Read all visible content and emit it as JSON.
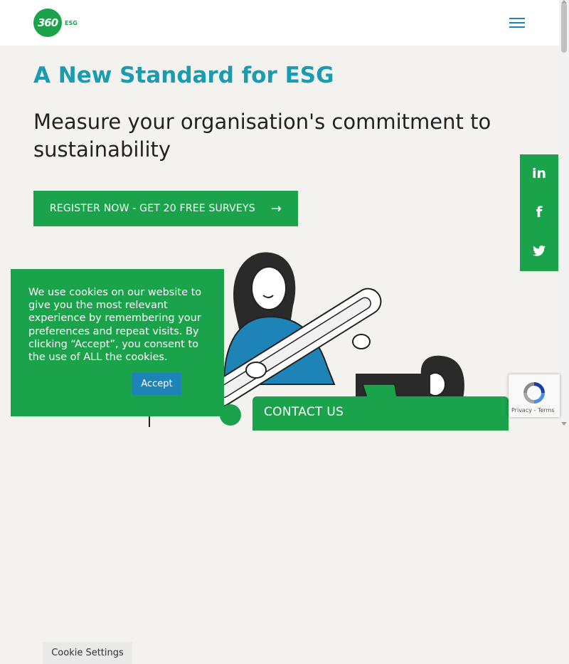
{
  "header": {
    "logo_mark": "360",
    "logo_text": "ESG",
    "menu_icon": "hamburger-icon"
  },
  "hero": {
    "title": "A New Standard for ESG",
    "subtitle": "Measure your organisation's commitment to sustainability",
    "cta_label": "REGISTER NOW - GET 20 FREE SURVEYS",
    "cta_icon": "arrow-right-icon"
  },
  "social": {
    "linkedin": "in",
    "facebook": "f",
    "twitter": "🐦"
  },
  "cookie": {
    "message": "We use cookies on our website to give you the most relevant experience by remembering your preferences and repeat visits. By clicking “Accept”, you consent to the use of ALL the cookies.",
    "settings_label": "Cookie Settings",
    "accept_label": "Accept"
  },
  "contact": {
    "label": "CONTACT US"
  },
  "recaptcha": {
    "links": "Privacy - Terms"
  },
  "colors": {
    "brand_green": "#1aa34a",
    "title_teal": "#1a9cb0",
    "accent_blue": "#1e84b8",
    "background": "#f4f2ee"
  }
}
